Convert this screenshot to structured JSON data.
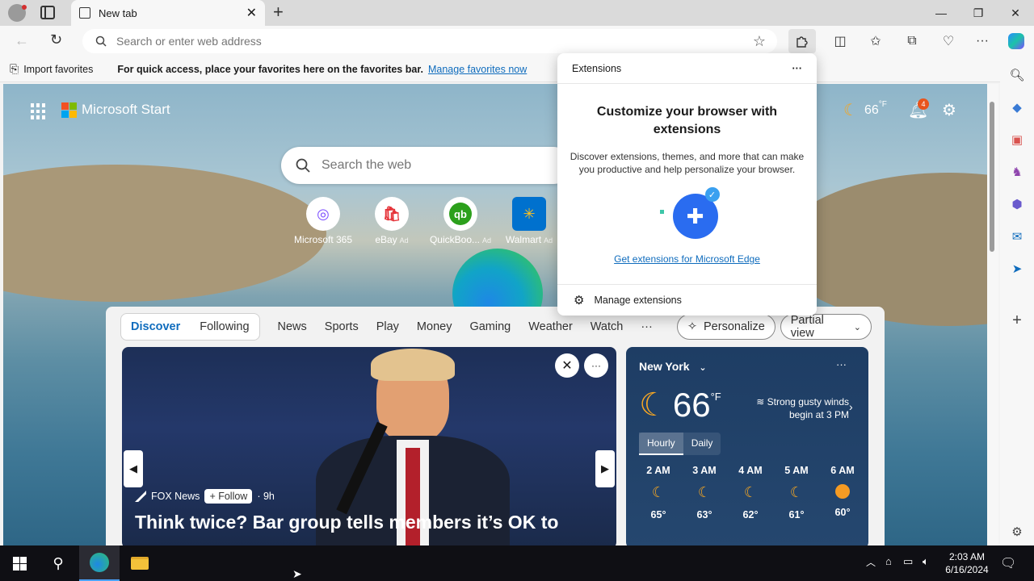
{
  "browser": {
    "tab_title": "New tab",
    "address_placeholder": "Search or enter web address",
    "favbar": {
      "import_label": "Import favorites",
      "message": "For quick access, place your favorites here on the favorites bar.",
      "manage_link": "Manage favorites now"
    }
  },
  "ms_start": {
    "brand": "Microsoft Start",
    "search_placeholder": "Search the web",
    "temperature": "66",
    "temp_unit": "°F",
    "notification_count": "4",
    "quick_links": [
      {
        "label": "Microsoft 365",
        "ad": ""
      },
      {
        "label": "eBay",
        "ad": "Ad"
      },
      {
        "label": "QuickBoo...",
        "ad": "Ad"
      },
      {
        "label": "Walmart",
        "ad": "Ad"
      }
    ]
  },
  "feed": {
    "toggle": [
      "Discover",
      "Following"
    ],
    "nav": [
      "News",
      "Sports",
      "Play",
      "Money",
      "Gaming",
      "Weather",
      "Watch"
    ],
    "more": "···",
    "personalize_label": "Personalize",
    "view_label": "Partial view",
    "hero": {
      "source": "FOX News",
      "follow_label": "+ Follow",
      "age": "· 9h",
      "headline": "Think twice? Bar group tells members it’s OK to"
    },
    "weather": {
      "city": "New York",
      "temp": "66",
      "unit": "°F",
      "alert": "Strong gusty winds begin at 3 PM",
      "tabs": [
        "Hourly",
        "Daily"
      ],
      "hours": [
        {
          "time": "2 AM",
          "temp": "65°",
          "icon": "moon"
        },
        {
          "time": "3 AM",
          "temp": "63°",
          "icon": "moon"
        },
        {
          "time": "4 AM",
          "temp": "62°",
          "icon": "moon"
        },
        {
          "time": "5 AM",
          "temp": "61°",
          "icon": "moon"
        },
        {
          "time": "6 AM",
          "temp": "60°",
          "icon": "sun"
        }
      ]
    }
  },
  "extensions_popup": {
    "header": "Extensions",
    "more": "···",
    "title": "Customize your browser with extensions",
    "description": "Discover extensions, themes, and more that can make you productive and help personalize your browser.",
    "link": "Get extensions for Microsoft Edge",
    "manage": "Manage extensions"
  },
  "taskbar": {
    "time": "2:03 AM",
    "date": "6/16/2024"
  },
  "colors": {
    "accent": "#0f6cbd",
    "taskbar": "#0f0f14"
  }
}
